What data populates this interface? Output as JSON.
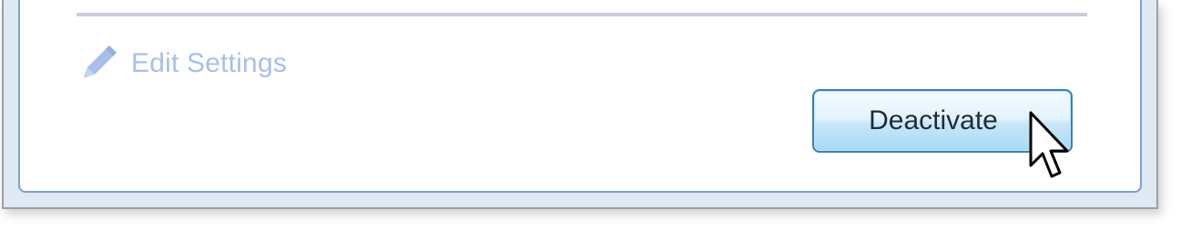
{
  "panel": {
    "edit_settings_label": "Edit Settings",
    "edit_icon": "pencil-icon",
    "deactivate_label": "Deactivate"
  },
  "cursor": {
    "icon": "arrow-cursor-icon"
  },
  "colors": {
    "panel_border": "#7ea2cf",
    "link_disabled": "#a8c0e8",
    "button_border": "#3c7fb1",
    "button_fill_top": "#e3f4fc",
    "button_fill_bottom": "#a7d9f5",
    "button_text": "#1f2a3d"
  }
}
